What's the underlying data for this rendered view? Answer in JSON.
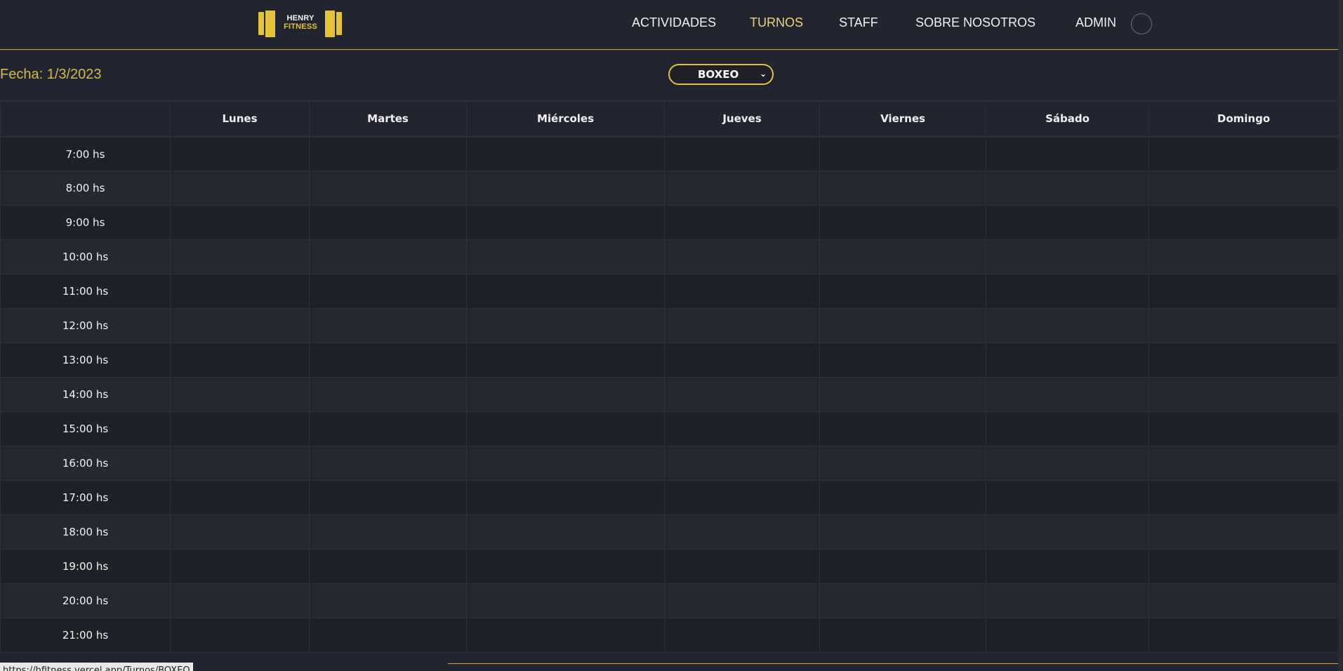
{
  "brand": {
    "line1": "HENRY",
    "line2": "FITNESS",
    "accent": "#e4c33b"
  },
  "nav": {
    "items": [
      {
        "label": "ACTIVIDADES",
        "active": false
      },
      {
        "label": "TURNOS",
        "active": true
      },
      {
        "label": "STAFF",
        "active": false
      },
      {
        "label": "SOBRE NOSOTROS",
        "active": false
      }
    ],
    "user_label": "ADMIN",
    "avatar_icon": "user-avatar-icon"
  },
  "toolbar": {
    "date_text": "Fecha: 1/3/2023",
    "activity_selected": "BOXEO",
    "select_icon": "chevron-down-icon"
  },
  "schedule": {
    "days": [
      "Lunes",
      "Martes",
      "Miércoles",
      "Jueves",
      "Viernes",
      "Sábado",
      "Domingo"
    ],
    "times": [
      "7:00 hs",
      "8:00 hs",
      "9:00 hs",
      "10:00 hs",
      "11:00 hs",
      "12:00 hs",
      "13:00 hs",
      "14:00 hs",
      "15:00 hs",
      "16:00 hs",
      "17:00 hs",
      "18:00 hs",
      "19:00 hs",
      "20:00 hs",
      "21:00 hs"
    ]
  },
  "status_bar": {
    "url": "https://hfitness.vercel.app/Turnos/BOXEO"
  },
  "colors": {
    "background": "#22252f",
    "accent": "#e4c33b",
    "active_nav": "#ecd27a",
    "date_text": "#d4b84a"
  }
}
